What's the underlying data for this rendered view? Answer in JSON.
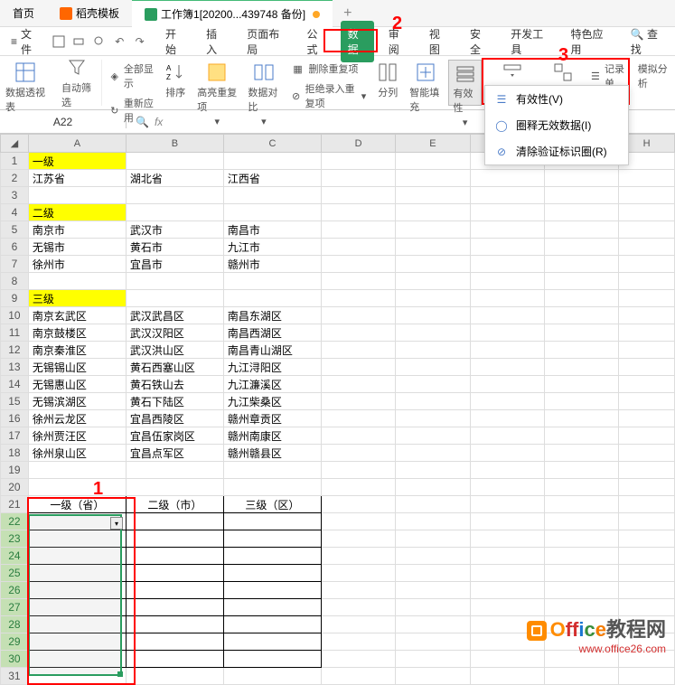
{
  "tabs": {
    "home": "首页",
    "template": "稻壳模板",
    "doc": "工作簿1[20200...439748 备份]"
  },
  "file_menu": "文件",
  "menu": {
    "start": "开始",
    "insert": "插入",
    "layout": "页面布局",
    "formula": "公式",
    "data": "数据",
    "review": "审阅",
    "view": "视图",
    "security": "安全",
    "devtools": "开发工具",
    "special": "特色应用",
    "search": "查找"
  },
  "ribbon": {
    "pivot": "数据透视表",
    "autofilter": "自动筛选",
    "showall": "全部显示",
    "reapply": "重新应用",
    "sort": "排序",
    "highlight": "高亮重复项",
    "compare": "数据对比",
    "dedupe": "删除重复项",
    "reject": "拒绝录入重复项",
    "split": "分列",
    "smartfill": "智能填充",
    "validity": "有效性",
    "dropdown": "插入下拉列表",
    "consolidate": "合并计算",
    "record": "记录单",
    "simulate": "模拟分析"
  },
  "validity_menu": {
    "validity": "有效性(V)",
    "circle": "圈释无效数据(I)",
    "clear": "清除验证标识圈(R)"
  },
  "namebox": "A22",
  "fx": "fx",
  "columns": [
    "A",
    "B",
    "C",
    "D",
    "E",
    "F",
    "G",
    "H"
  ],
  "rows": {
    "1": {
      "A": "一级"
    },
    "2": {
      "A": "江苏省",
      "B": "湖北省",
      "C": "江西省"
    },
    "4": {
      "A": "二级"
    },
    "5": {
      "A": "南京市",
      "B": "武汉市",
      "C": "南昌市"
    },
    "6": {
      "A": "无锡市",
      "B": "黄石市",
      "C": "九江市"
    },
    "7": {
      "A": "徐州市",
      "B": "宜昌市",
      "C": "赣州市"
    },
    "9": {
      "A": "三级"
    },
    "10": {
      "A": "南京玄武区",
      "B": "武汉武昌区",
      "C": "南昌东湖区"
    },
    "11": {
      "A": "南京鼓楼区",
      "B": "武汉汉阳区",
      "C": "南昌西湖区"
    },
    "12": {
      "A": "南京秦淮区",
      "B": "武汉洪山区",
      "C": "南昌青山湖区"
    },
    "13": {
      "A": "无锡锡山区",
      "B": "黄石西塞山区",
      "C": "九江浔阳区"
    },
    "14": {
      "A": "无锡惠山区",
      "B": "黄石铁山去",
      "C": "九江濂溪区"
    },
    "15": {
      "A": "无锡滨湖区",
      "B": "黄石下陆区",
      "C": "九江柴桑区"
    },
    "16": {
      "A": "徐州云龙区",
      "B": "宜昌西陵区",
      "C": "赣州章贡区"
    },
    "17": {
      "A": "徐州贾汪区",
      "B": "宜昌伍家岗区",
      "C": "赣州南康区"
    },
    "18": {
      "A": "徐州泉山区",
      "B": "宜昌点军区",
      "C": "赣州赣县区"
    },
    "21": {
      "A": "一级（省）",
      "B": "二级（市）",
      "C": "三级（区）"
    }
  },
  "annotations": {
    "n1": "1",
    "n2": "2",
    "n3": "3"
  },
  "watermark": {
    "line1": "Office教程网",
    "line2": "www.office26.com"
  }
}
